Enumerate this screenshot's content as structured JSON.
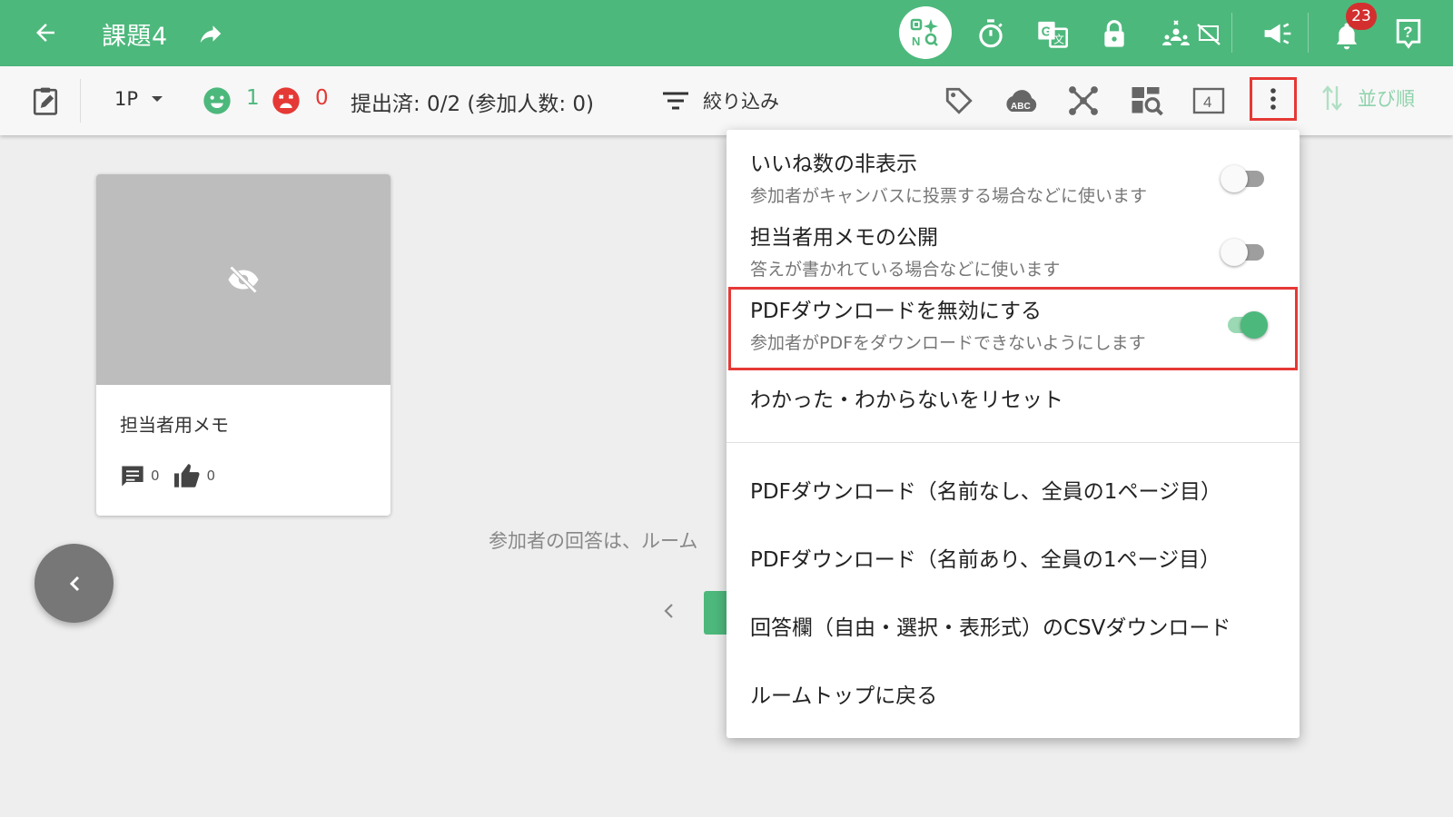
{
  "header": {
    "title": "課題4",
    "notification_count": "23",
    "colors": {
      "primary": "#4db87c",
      "badge": "#d32f2f",
      "highlight": "#e53935"
    },
    "icons": [
      "back-arrow-icon",
      "share-arrow-icon",
      "ai-assist-icon",
      "timer-icon",
      "translate-icon",
      "lock-icon",
      "hide-presenter-icon",
      "broadcast-icon",
      "bell-icon",
      "help-icon"
    ]
  },
  "toolbar": {
    "page": "1P",
    "understood_count": "1",
    "not_understood_count": "0",
    "submitted_text": "提出済: 0/2 (参加人数: 0)",
    "filter_label": "絞り込み",
    "sort_label": "並び順",
    "icons": [
      "edit-note-icon",
      "tag-icon",
      "abc-icon",
      "network-icon",
      "search-grid-icon",
      "page-4-icon",
      "more-vert-icon"
    ]
  },
  "card": {
    "title": "担当者用メモ",
    "comments": "0",
    "likes": "0"
  },
  "background": {
    "message": "参加者の回答は、ルーム"
  },
  "menu": {
    "toggles": [
      {
        "title": "いいね数の非表示",
        "subtitle": "参加者がキャンバスに投票する場合などに使います",
        "on": false
      },
      {
        "title": "担当者用メモの公開",
        "subtitle": "答えが書かれている場合などに使います",
        "on": false
      },
      {
        "title": "PDFダウンロードを無効にする",
        "subtitle": "参加者がPDFをダウンロードできないようにします",
        "on": true
      }
    ],
    "reset_label": "わかった・わからないをリセット",
    "actions": [
      "PDFダウンロード（名前なし、全員の1ページ目）",
      "PDFダウンロード（名前あり、全員の1ページ目）",
      "回答欄（自由・選択・表形式）のCSVダウンロード",
      "ルームトップに戻る"
    ]
  }
}
